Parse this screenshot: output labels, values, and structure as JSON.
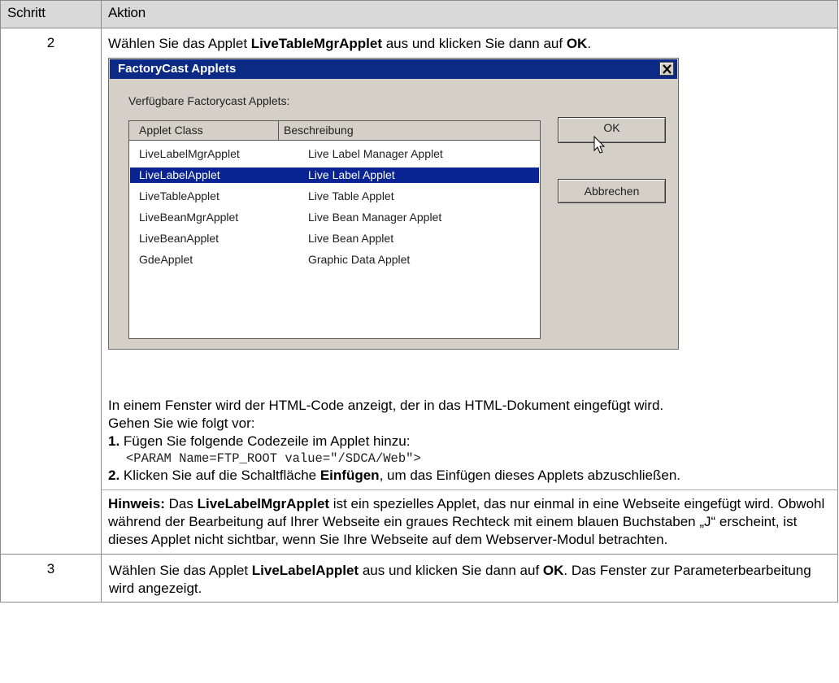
{
  "table": {
    "header_step": "Schritt",
    "header_action": "Aktion"
  },
  "row2": {
    "step": "2",
    "intro_pre": "Wählen Sie das Applet ",
    "intro_bold": "LiveTableMgrApplet",
    "intro_mid": " aus und klicken Sie dann auf ",
    "intro_ok": "OK",
    "intro_end": ".",
    "dialog": {
      "title": "FactoryCast Applets",
      "available_label": "Verfügbare Factorycast Applets:",
      "col_class": "Applet Class",
      "col_desc": "Beschreibung",
      "ok_label": "OK",
      "cancel_label": "Abbrechen",
      "rows": [
        {
          "cls": "LiveLabelMgrApplet",
          "desc": "Live Label Manager Applet"
        },
        {
          "cls": "LiveLabelApplet",
          "desc": "Live Label Applet"
        },
        {
          "cls": "LiveTableApplet",
          "desc": "Live Table Applet"
        },
        {
          "cls": "LiveBeanMgrApplet",
          "desc": "Live Bean Manager Applet"
        },
        {
          "cls": "LiveBeanApplet",
          "desc": "Live Bean Applet"
        },
        {
          "cls": "GdeApplet",
          "desc": "Graphic Data Applet"
        }
      ],
      "selected_row": "LiveLabelApplet"
    },
    "para1": "In einem Fenster wird der HTML-Code anzeigt, der in das HTML-Dokument eingefügt wird.",
    "para2": "Gehen Sie wie folgt vor:",
    "step1_num": "1.",
    "step1_text": " Fügen Sie folgende Codezeile im Applet hinzu:",
    "code_line": "<PARAM Name=FTP_ROOT value=\"/SDCA/Web\">",
    "step2_num": "2.",
    "step2_pre": " Klicken Sie auf die Schaltfläche ",
    "step2_bold": "Einfügen",
    "step2_end": ", um das Einfügen dieses Applets abzuschließen.",
    "note_label": "Hinweis:",
    "note_pre": " Das ",
    "note_bold": "LiveLabelMgrApplet",
    "note_text": " ist ein spezielles Applet, das nur einmal in eine Webseite eingefügt wird. Obwohl während der Bearbeitung auf Ihrer Webseite ein graues Rechteck mit einem blauen Buchstaben „J“ erscheint, ist dieses Applet nicht sichtbar, wenn Sie Ihre Webseite auf dem Webserver-Modul betrachten."
  },
  "row3": {
    "step": "3",
    "text_pre": "Wählen Sie das Applet ",
    "text_bold": "LiveLabelApplet",
    "text_mid": " aus und klicken Sie dann auf ",
    "text_ok": "OK",
    "text_end": ". Das Fenster zur Parameterbearbeitung wird angezeigt."
  },
  "icons": {
    "close": "close-x-icon",
    "cursor": "mouse-pointer-icon"
  }
}
